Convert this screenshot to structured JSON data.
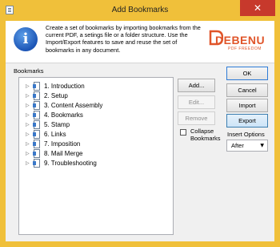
{
  "window": {
    "title": "Add Bookmarks",
    "close_glyph": "✕"
  },
  "header": {
    "description": "Create a set of bookmarks by importing bookmarks from the current PDF, a setings file or a folder structure. Use the Import/Export features to save and reuse the set of bookmarks in any document.",
    "logo_word": "DEBENU",
    "logo_sub": "PDF FREEDOM",
    "info_glyph": "i"
  },
  "bookmarks": {
    "group_label": "Bookmarks",
    "items": [
      {
        "label": "1. Introduction"
      },
      {
        "label": "2. Setup"
      },
      {
        "label": "3. Content Assembly"
      },
      {
        "label": "4. Bookmarks"
      },
      {
        "label": "5. Stamp"
      },
      {
        "label": "6. Links"
      },
      {
        "label": "7. Imposition"
      },
      {
        "label": "8. Mail Merge"
      },
      {
        "label": "9. Troubleshooting"
      }
    ],
    "expander_glyph": "▷"
  },
  "middle_buttons": {
    "add": "Add...",
    "edit": "Edit...",
    "remove": "Remove",
    "collapse_label": "Collapse Bookmarks",
    "collapse_checked": false
  },
  "right_buttons": {
    "ok": "OK",
    "cancel": "Cancel",
    "import": "Import",
    "export": "Export",
    "insert_options_label": "Insert Options",
    "insert_selected": "After",
    "select_arrow": "▼"
  },
  "colors": {
    "titlebar": "#f0c03a",
    "close": "#c7392c",
    "brand": "#e0552a",
    "info": "#1c55b6"
  }
}
